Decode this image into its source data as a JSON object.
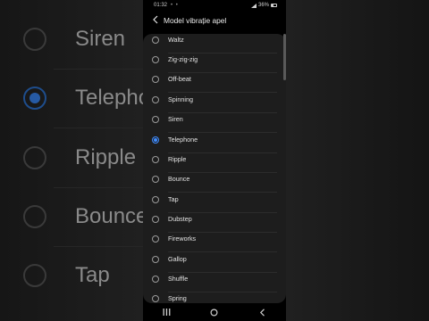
{
  "status_bar": {
    "time": "01:32",
    "dots": "• •",
    "battery": "36%"
  },
  "header": {
    "title": "Model vibrație apel"
  },
  "options": [
    {
      "label": "Waltz",
      "selected": false
    },
    {
      "label": "Zig-zig-zig",
      "selected": false
    },
    {
      "label": "Off-beat",
      "selected": false
    },
    {
      "label": "Spinning",
      "selected": false
    },
    {
      "label": "Siren",
      "selected": false
    },
    {
      "label": "Telephone",
      "selected": true
    },
    {
      "label": "Ripple",
      "selected": false
    },
    {
      "label": "Bounce",
      "selected": false
    },
    {
      "label": "Tap",
      "selected": false
    },
    {
      "label": "Dubstep",
      "selected": false
    },
    {
      "label": "Fireworks",
      "selected": false
    },
    {
      "label": "Gallop",
      "selected": false
    },
    {
      "label": "Shuffle",
      "selected": false
    },
    {
      "label": "Spring",
      "selected": false
    }
  ],
  "background_labels": [
    "Siren",
    "Telephone",
    "Ripple",
    "Bounce",
    "Tap"
  ],
  "colors": {
    "accent": "#3f8cff",
    "card": "#1d1d1d",
    "background": "#000000"
  },
  "icons": {
    "back": "back-arrow-icon",
    "recents": "recents-icon",
    "home": "home-icon",
    "nav_back": "nav-back-icon"
  }
}
